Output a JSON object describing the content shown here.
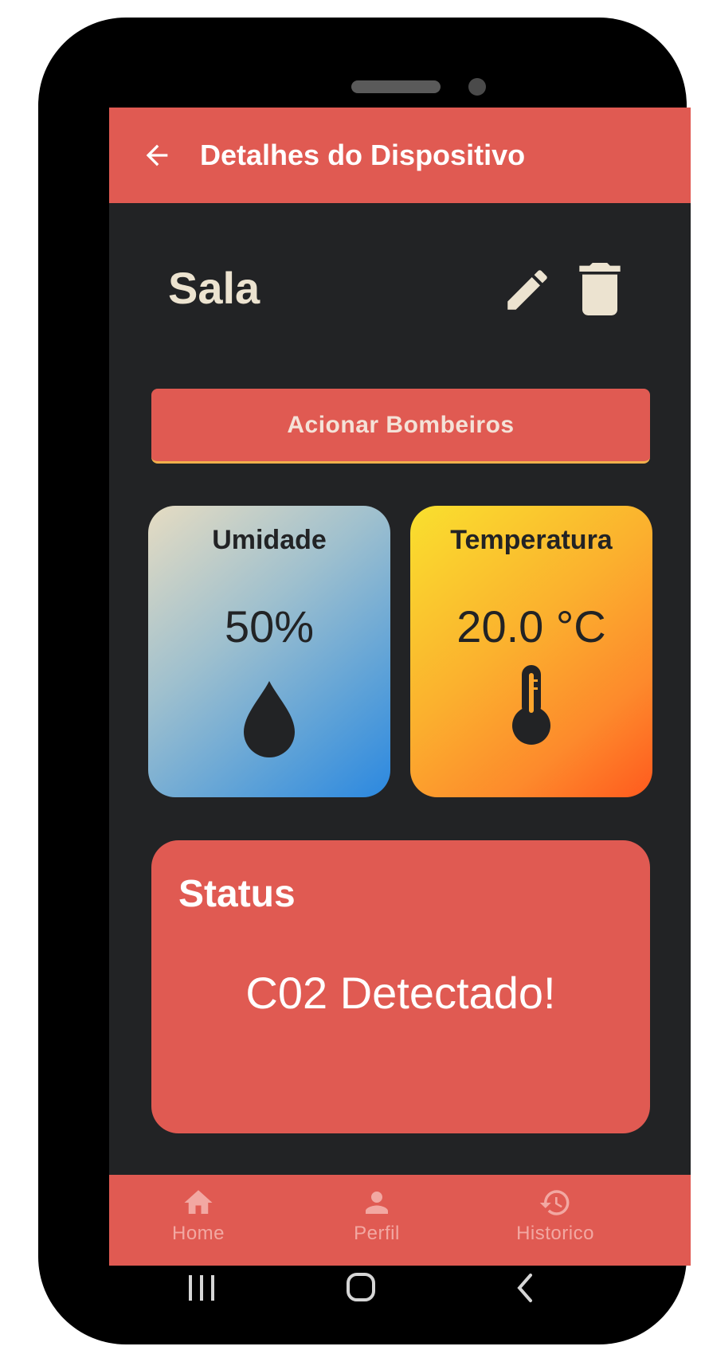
{
  "appbar": {
    "title": "Detalhes do Dispositivo",
    "back_icon": "arrow-left-icon"
  },
  "device": {
    "name": "Sala",
    "edit_icon": "pencil-icon",
    "delete_icon": "trash-icon"
  },
  "action_button": {
    "label": "Acionar Bombeiros"
  },
  "cards": {
    "humidity": {
      "title": "Umidade",
      "value": "50%",
      "icon": "water-drop-icon"
    },
    "temperature": {
      "title": "Temperatura",
      "value": "20.0 °C",
      "icon": "thermometer-icon"
    }
  },
  "status": {
    "title": "Status",
    "message": "C02 Detectado!"
  },
  "bottom_nav": {
    "items": [
      {
        "label": "Home",
        "icon": "home-icon"
      },
      {
        "label": "Perfil",
        "icon": "person-icon"
      },
      {
        "label": "Historico",
        "icon": "history-icon"
      }
    ]
  },
  "colors": {
    "primary": "#e05a52",
    "background": "#222325",
    "text_light": "#ece3d0",
    "nav_inactive": "#f2a8a2"
  }
}
